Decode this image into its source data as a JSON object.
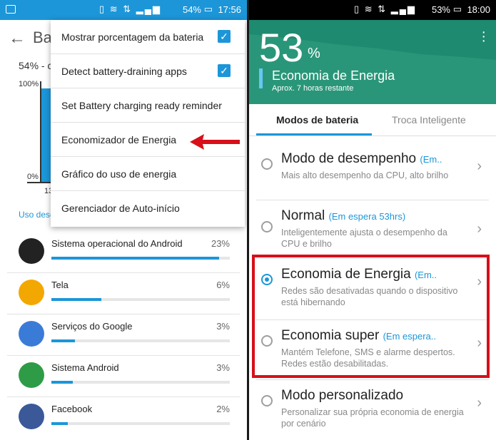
{
  "left": {
    "status_bar": {
      "battery": "54%",
      "time": "17:56"
    },
    "title": "Ba",
    "battery_sub": "54% - c",
    "chart": {
      "tick_top": "100%",
      "tick_bottom": "0%",
      "x_tick": "13"
    },
    "usage_link": "Uso desc",
    "apps": [
      {
        "name": "Sistema operacional do Android",
        "pct": "23%",
        "usage": 0.94,
        "icon": "android-icon",
        "color": "#222222"
      },
      {
        "name": "Tela",
        "pct": "6%",
        "usage": 0.28,
        "icon": "brightness-icon",
        "color": "#f2a800"
      },
      {
        "name": "Serviços do Google",
        "pct": "3%",
        "usage": 0.13,
        "icon": "google-services-icon",
        "color": "#3b7bd8"
      },
      {
        "name": "Sistema Android",
        "pct": "3%",
        "usage": 0.12,
        "icon": "android-system-icon",
        "color": "#2e9c47"
      },
      {
        "name": "Facebook",
        "pct": "2%",
        "usage": 0.09,
        "icon": "facebook-icon",
        "color": "#3b5998"
      }
    ],
    "menu": {
      "items": [
        {
          "label": "Mostrar porcentagem da bateria",
          "checked": true
        },
        {
          "label": "Detect battery-draining apps",
          "checked": true
        },
        {
          "label": "Set Battery charging ready reminder",
          "checked": false
        },
        {
          "label": "Economizador de Energia",
          "checked": false
        },
        {
          "label": "Gráfico do uso de energia",
          "checked": false
        },
        {
          "label": "Gerenciador de Auto-início",
          "checked": false
        }
      ]
    }
  },
  "right": {
    "status_bar": {
      "battery": "53%",
      "time": "18:00"
    },
    "header": {
      "percent": "53",
      "percent_sign": "%",
      "title": "Economia de Energia",
      "subtitle": "Aprox. 7 horas restante"
    },
    "tabs": [
      {
        "label": "Modos de bateria"
      },
      {
        "label": "Troca Inteligente"
      }
    ],
    "modes": [
      {
        "title": "Modo de desempenho",
        "status": "(Em..",
        "desc": "Mais alto desempenho da CPU, alto brilho",
        "selected": false
      },
      {
        "title": "Normal",
        "status": "(Em espera 53hrs)",
        "desc": "Inteligentemente ajusta o desempenho da CPU e brilho",
        "selected": false
      },
      {
        "title": "Economia de Energia",
        "status": "(Em..",
        "desc": "Redes são desativadas quando o dispositivo está hibernando",
        "selected": true
      },
      {
        "title": "Economia super",
        "status": "(Em espera..",
        "desc": "Mantém Telefone, SMS e alarme despertos. Redes estão desabilitadas.",
        "selected": false
      },
      {
        "title": "Modo personalizado",
        "status": "",
        "desc": "Personalizar sua própria economia de energia por cenário",
        "selected": false
      }
    ]
  },
  "colors": {
    "accent": "#1c96d8",
    "header_green": "#1e8a70",
    "highlight_red": "#d70f19"
  }
}
